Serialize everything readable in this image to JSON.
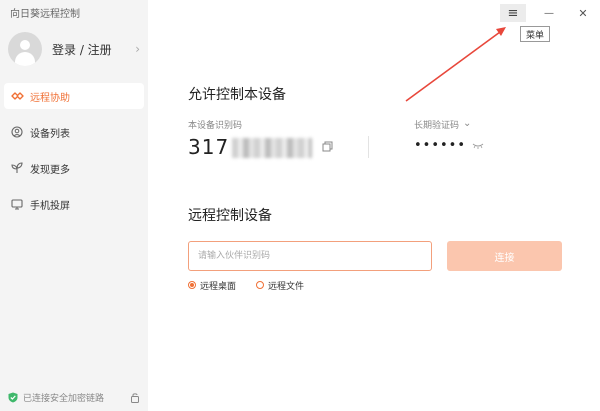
{
  "app": {
    "title": "向日葵远程控制"
  },
  "account": {
    "login_label": "登录 / 注册",
    "chevron": "›"
  },
  "sidebar": {
    "items": [
      {
        "label": "远程协助",
        "icon": "remote-assist-icon",
        "active": true
      },
      {
        "label": "设备列表",
        "icon": "device-list-icon",
        "active": false
      },
      {
        "label": "发现更多",
        "icon": "discover-icon",
        "active": false
      },
      {
        "label": "手机投屏",
        "icon": "screen-cast-icon",
        "active": false
      }
    ],
    "status": "已连接安全加密链路"
  },
  "window": {
    "menu_tooltip": "菜单",
    "menu_icon": "≡",
    "minimize_icon": "—",
    "close_icon": "✕"
  },
  "allow": {
    "title": "允许控制本设备",
    "device_id_label": "本设备识别码",
    "device_id_prefix": "317",
    "password_label": "长期验证码",
    "password_chevron": "⌄",
    "password_mask": "••••••"
  },
  "remote": {
    "title": "远程控制设备",
    "input_placeholder": "请输入伙伴识别码",
    "connect_label": "连接",
    "modes": [
      {
        "label": "远程桌面",
        "selected": true
      },
      {
        "label": "远程文件",
        "selected": false
      }
    ]
  },
  "colors": {
    "accent": "#f07035",
    "annotation": "#e8473b",
    "connect_disabled": "#fbc6ae"
  }
}
